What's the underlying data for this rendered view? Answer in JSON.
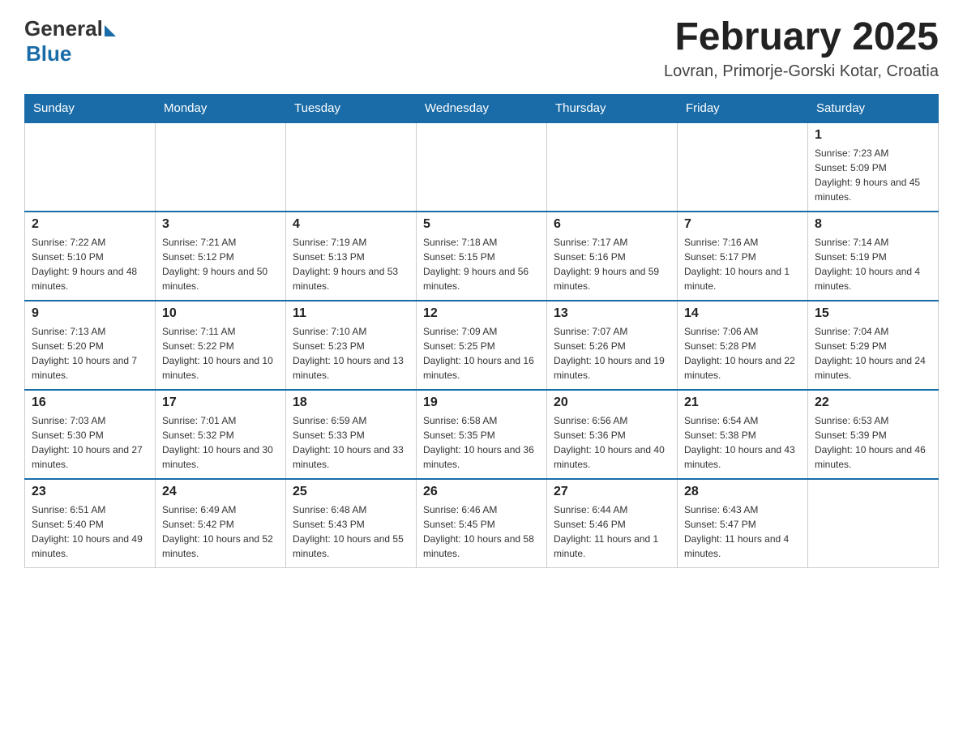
{
  "header": {
    "logo_general": "General",
    "logo_blue": "Blue",
    "month_title": "February 2025",
    "location": "Lovran, Primorje-Gorski Kotar, Croatia"
  },
  "weekdays": [
    "Sunday",
    "Monday",
    "Tuesday",
    "Wednesday",
    "Thursday",
    "Friday",
    "Saturday"
  ],
  "weeks": [
    [
      {
        "day": "",
        "sunrise": "",
        "sunset": "",
        "daylight": ""
      },
      {
        "day": "",
        "sunrise": "",
        "sunset": "",
        "daylight": ""
      },
      {
        "day": "",
        "sunrise": "",
        "sunset": "",
        "daylight": ""
      },
      {
        "day": "",
        "sunrise": "",
        "sunset": "",
        "daylight": ""
      },
      {
        "day": "",
        "sunrise": "",
        "sunset": "",
        "daylight": ""
      },
      {
        "day": "",
        "sunrise": "",
        "sunset": "",
        "daylight": ""
      },
      {
        "day": "1",
        "sunrise": "Sunrise: 7:23 AM",
        "sunset": "Sunset: 5:09 PM",
        "daylight": "Daylight: 9 hours and 45 minutes."
      }
    ],
    [
      {
        "day": "2",
        "sunrise": "Sunrise: 7:22 AM",
        "sunset": "Sunset: 5:10 PM",
        "daylight": "Daylight: 9 hours and 48 minutes."
      },
      {
        "day": "3",
        "sunrise": "Sunrise: 7:21 AM",
        "sunset": "Sunset: 5:12 PM",
        "daylight": "Daylight: 9 hours and 50 minutes."
      },
      {
        "day": "4",
        "sunrise": "Sunrise: 7:19 AM",
        "sunset": "Sunset: 5:13 PM",
        "daylight": "Daylight: 9 hours and 53 minutes."
      },
      {
        "day": "5",
        "sunrise": "Sunrise: 7:18 AM",
        "sunset": "Sunset: 5:15 PM",
        "daylight": "Daylight: 9 hours and 56 minutes."
      },
      {
        "day": "6",
        "sunrise": "Sunrise: 7:17 AM",
        "sunset": "Sunset: 5:16 PM",
        "daylight": "Daylight: 9 hours and 59 minutes."
      },
      {
        "day": "7",
        "sunrise": "Sunrise: 7:16 AM",
        "sunset": "Sunset: 5:17 PM",
        "daylight": "Daylight: 10 hours and 1 minute."
      },
      {
        "day": "8",
        "sunrise": "Sunrise: 7:14 AM",
        "sunset": "Sunset: 5:19 PM",
        "daylight": "Daylight: 10 hours and 4 minutes."
      }
    ],
    [
      {
        "day": "9",
        "sunrise": "Sunrise: 7:13 AM",
        "sunset": "Sunset: 5:20 PM",
        "daylight": "Daylight: 10 hours and 7 minutes."
      },
      {
        "day": "10",
        "sunrise": "Sunrise: 7:11 AM",
        "sunset": "Sunset: 5:22 PM",
        "daylight": "Daylight: 10 hours and 10 minutes."
      },
      {
        "day": "11",
        "sunrise": "Sunrise: 7:10 AM",
        "sunset": "Sunset: 5:23 PM",
        "daylight": "Daylight: 10 hours and 13 minutes."
      },
      {
        "day": "12",
        "sunrise": "Sunrise: 7:09 AM",
        "sunset": "Sunset: 5:25 PM",
        "daylight": "Daylight: 10 hours and 16 minutes."
      },
      {
        "day": "13",
        "sunrise": "Sunrise: 7:07 AM",
        "sunset": "Sunset: 5:26 PM",
        "daylight": "Daylight: 10 hours and 19 minutes."
      },
      {
        "day": "14",
        "sunrise": "Sunrise: 7:06 AM",
        "sunset": "Sunset: 5:28 PM",
        "daylight": "Daylight: 10 hours and 22 minutes."
      },
      {
        "day": "15",
        "sunrise": "Sunrise: 7:04 AM",
        "sunset": "Sunset: 5:29 PM",
        "daylight": "Daylight: 10 hours and 24 minutes."
      }
    ],
    [
      {
        "day": "16",
        "sunrise": "Sunrise: 7:03 AM",
        "sunset": "Sunset: 5:30 PM",
        "daylight": "Daylight: 10 hours and 27 minutes."
      },
      {
        "day": "17",
        "sunrise": "Sunrise: 7:01 AM",
        "sunset": "Sunset: 5:32 PM",
        "daylight": "Daylight: 10 hours and 30 minutes."
      },
      {
        "day": "18",
        "sunrise": "Sunrise: 6:59 AM",
        "sunset": "Sunset: 5:33 PM",
        "daylight": "Daylight: 10 hours and 33 minutes."
      },
      {
        "day": "19",
        "sunrise": "Sunrise: 6:58 AM",
        "sunset": "Sunset: 5:35 PM",
        "daylight": "Daylight: 10 hours and 36 minutes."
      },
      {
        "day": "20",
        "sunrise": "Sunrise: 6:56 AM",
        "sunset": "Sunset: 5:36 PM",
        "daylight": "Daylight: 10 hours and 40 minutes."
      },
      {
        "day": "21",
        "sunrise": "Sunrise: 6:54 AM",
        "sunset": "Sunset: 5:38 PM",
        "daylight": "Daylight: 10 hours and 43 minutes."
      },
      {
        "day": "22",
        "sunrise": "Sunrise: 6:53 AM",
        "sunset": "Sunset: 5:39 PM",
        "daylight": "Daylight: 10 hours and 46 minutes."
      }
    ],
    [
      {
        "day": "23",
        "sunrise": "Sunrise: 6:51 AM",
        "sunset": "Sunset: 5:40 PM",
        "daylight": "Daylight: 10 hours and 49 minutes."
      },
      {
        "day": "24",
        "sunrise": "Sunrise: 6:49 AM",
        "sunset": "Sunset: 5:42 PM",
        "daylight": "Daylight: 10 hours and 52 minutes."
      },
      {
        "day": "25",
        "sunrise": "Sunrise: 6:48 AM",
        "sunset": "Sunset: 5:43 PM",
        "daylight": "Daylight: 10 hours and 55 minutes."
      },
      {
        "day": "26",
        "sunrise": "Sunrise: 6:46 AM",
        "sunset": "Sunset: 5:45 PM",
        "daylight": "Daylight: 10 hours and 58 minutes."
      },
      {
        "day": "27",
        "sunrise": "Sunrise: 6:44 AM",
        "sunset": "Sunset: 5:46 PM",
        "daylight": "Daylight: 11 hours and 1 minute."
      },
      {
        "day": "28",
        "sunrise": "Sunrise: 6:43 AM",
        "sunset": "Sunset: 5:47 PM",
        "daylight": "Daylight: 11 hours and 4 minutes."
      },
      {
        "day": "",
        "sunrise": "",
        "sunset": "",
        "daylight": ""
      }
    ]
  ]
}
